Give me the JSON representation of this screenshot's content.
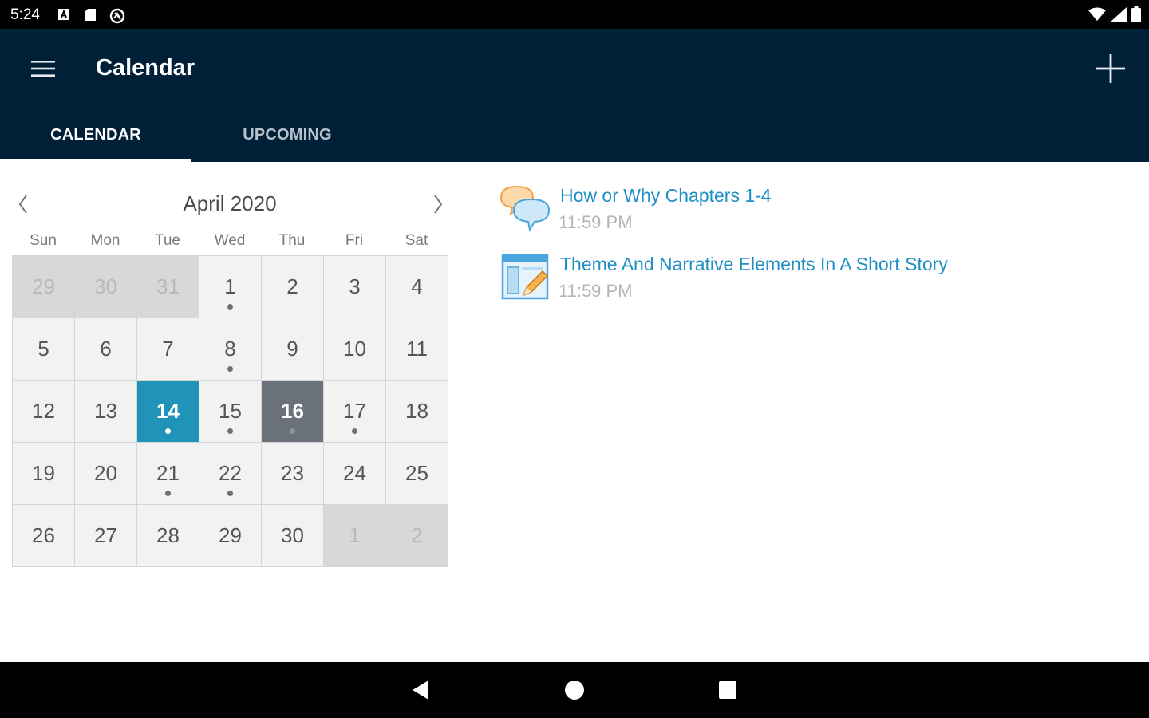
{
  "status": {
    "time": "5:24"
  },
  "app": {
    "title": "Calendar"
  },
  "tabs": [
    {
      "label": "CALENDAR",
      "active": true
    },
    {
      "label": "UPCOMING",
      "active": false
    }
  ],
  "calendar": {
    "month_title": "April 2020",
    "weekdays": [
      "Sun",
      "Mon",
      "Tue",
      "Wed",
      "Thu",
      "Fri",
      "Sat"
    ],
    "weeks": [
      [
        {
          "d": "29",
          "out": true
        },
        {
          "d": "30",
          "out": true
        },
        {
          "d": "31",
          "out": true
        },
        {
          "d": "1",
          "dot": true
        },
        {
          "d": "2"
        },
        {
          "d": "3"
        },
        {
          "d": "4"
        }
      ],
      [
        {
          "d": "5"
        },
        {
          "d": "6"
        },
        {
          "d": "7"
        },
        {
          "d": "8",
          "dot": true
        },
        {
          "d": "9"
        },
        {
          "d": "10"
        },
        {
          "d": "11"
        }
      ],
      [
        {
          "d": "12"
        },
        {
          "d": "13"
        },
        {
          "d": "14",
          "dot": true,
          "state": "today"
        },
        {
          "d": "15",
          "dot": true
        },
        {
          "d": "16",
          "dot": true,
          "state": "selected"
        },
        {
          "d": "17",
          "dot": true
        },
        {
          "d": "18"
        }
      ],
      [
        {
          "d": "19"
        },
        {
          "d": "20"
        },
        {
          "d": "21",
          "dot": true
        },
        {
          "d": "22",
          "dot": true
        },
        {
          "d": "23"
        },
        {
          "d": "24"
        },
        {
          "d": "25"
        }
      ],
      [
        {
          "d": "26"
        },
        {
          "d": "27"
        },
        {
          "d": "28"
        },
        {
          "d": "29"
        },
        {
          "d": "30"
        },
        {
          "d": "1",
          "out": true
        },
        {
          "d": "2",
          "out": true
        }
      ]
    ]
  },
  "events": [
    {
      "title": "How or Why Chapters 1-4",
      "time": "11:59 PM",
      "icon": "discussion-icon"
    },
    {
      "title": "Theme And Narrative Elements In A Short Story",
      "time": "11:59 PM",
      "icon": "assignment-icon"
    }
  ],
  "colors": {
    "app_bar": "#002038",
    "today": "#1f93b8",
    "selected": "#6a717a",
    "link": "#1f8fc4"
  }
}
